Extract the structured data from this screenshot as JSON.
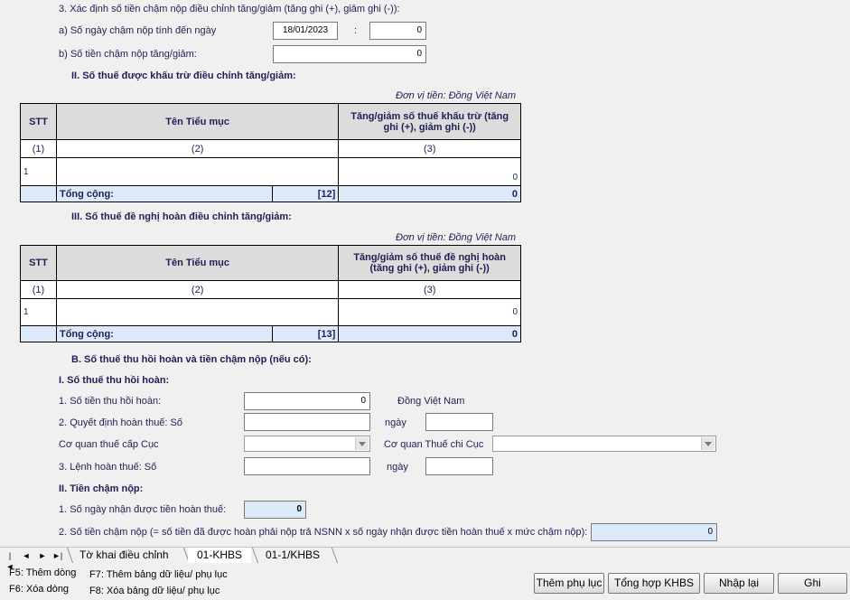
{
  "sec3": {
    "title": "3. Xác định số tiền chậm nộp điều chỉnh tăng/giảm (tăng ghi (+), giảm ghi (-)):",
    "a_label": "a) Số ngày chậm nộp tính đến ngày",
    "a_date": "18/01/2023",
    "a_colon": ":",
    "a_days": "0",
    "b_label": "b) Số tiền chậm nộp tăng/giảm:",
    "b_value": "0"
  },
  "secII": {
    "title": "II. Số thuế được khấu trừ điều chỉnh tăng/giảm:",
    "unit": "Đơn vị tiền: Đồng Việt Nam",
    "col_stt": "STT",
    "col_name": "Tên Tiểu mục",
    "col_value_1": "Tăng/giảm số thuế khấu trừ (tăng",
    "col_value_2": "ghi (+), giảm ghi (-))",
    "idx1": "(1)",
    "idx2": "(2)",
    "idx3": "(3)",
    "row_stt": "1",
    "row_value": "0",
    "total_label": "Tổng cộng:",
    "total_code": "[12]",
    "total_value": "0"
  },
  "secIII": {
    "title": "III. Số thuế đề nghị hoàn điều chỉnh tăng/giảm:",
    "unit": "Đơn vị tiền: Đồng Việt Nam",
    "col_stt": "STT",
    "col_name": "Tên Tiểu mục",
    "col_value_1": "Tăng/giảm số thuế đề nghị hoàn",
    "col_value_2": "(tăng ghi (+), giảm ghi (-))",
    "idx1": "(1)",
    "idx2": "(2)",
    "idx3": "(3)",
    "row_stt": "1",
    "row_value": "0",
    "total_label": "Tổng cộng:",
    "total_code": "[13]",
    "total_value": "0"
  },
  "secB": {
    "title": "B. Số thuế thu hồi hoàn và tiền chậm nộp (nếu có):",
    "sub1": "I. Số thuế thu hồi hoàn:",
    "l1": "1. Số tiền thu hồi hoàn:",
    "l1_value": "0",
    "l1_unit": "Đồng Việt Nam",
    "l2": "2. Quyết định hoàn thuế: Số",
    "ngay": "ngày",
    "l_cq_cuc": "Cơ quan thuế cấp Cục",
    "l_cq_chicuc": "Cơ quan Thuế chi Cục",
    "l3": "3. Lệnh hoàn thuế: Số",
    "ngay2": "ngày",
    "sub2": "II. Tiền chậm nộp:",
    "m1": "1. Số ngày nhận được tiền hoàn thuế:",
    "m1_value": "0",
    "m2": "2. Số tiền chậm nộp (= số tiền đã được hoàn phải nộp trả NSNN x số ngày nhận được tiền hoàn thuế x mức chậm nộp):",
    "m2_value": "0"
  },
  "tabs": {
    "tab1": "Tờ khai điều chỉnh",
    "tab2": "01-KHBS",
    "tab3": "01-1/KHBS"
  },
  "footer": {
    "f5_add": "F5: Thêm dòng",
    "f6_del": "F6: Xóa dòng",
    "f7": "F7: Thêm bảng dữ liệu/ phụ lục",
    "f8": "F8: Xóa bảng dữ liệu/ phụ lục",
    "btn_appendix": "Thêm phụ lục",
    "btn_summary": "Tổng hợp KHBS",
    "btn_reset": "Nhập lại",
    "btn_save": "Ghi"
  }
}
